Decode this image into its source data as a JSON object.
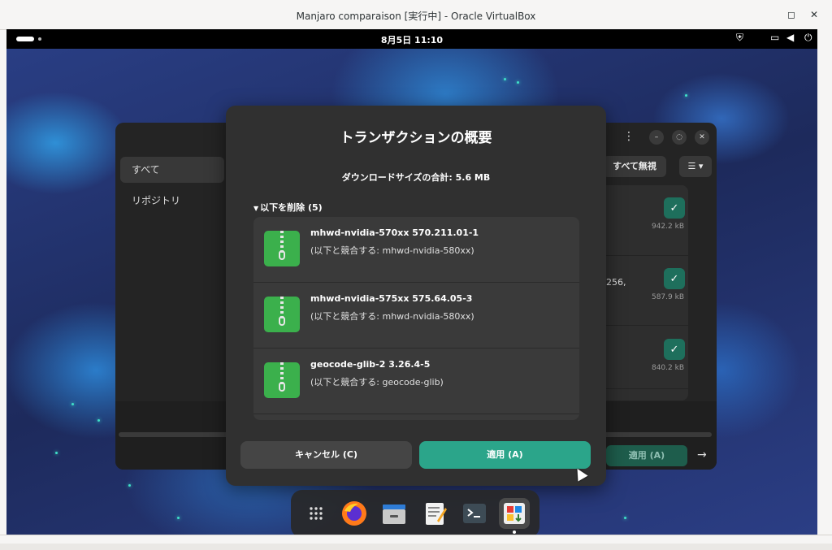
{
  "host": {
    "title": "Manjaro comparaison [実行中] - Oracle VirtualBox",
    "restore_glyph": "◻",
    "close_glyph": "✕"
  },
  "topbar": {
    "clock": "8月5日  11:10"
  },
  "background_window": {
    "sidebar": [
      "すべて",
      "リポジトリ"
    ],
    "ignore_all_label": "すべて無視",
    "view_label": "☰ ▾",
    "rows": [
      {
        "size": "942.2 kB",
        "trunc": ""
      },
      {
        "size": "587.9 kB",
        "trunc": "-256,"
      },
      {
        "size": "840.2 kB",
        "trunc": ""
      }
    ],
    "apply_label": "適用 (A)",
    "next_glyph": "→"
  },
  "dialog": {
    "title": "トランザクションの概要",
    "download_size": "ダウンロードサイズの合計: 5.6 MB",
    "section_header": "以下を削除 (5)",
    "packages": [
      {
        "name": "mhwd-nvidia-570xx  570.211.01-1",
        "conflict": "(以下と競合する: mhwd-nvidia-580xx)"
      },
      {
        "name": "mhwd-nvidia-575xx  575.64.05-3",
        "conflict": "(以下と競合する: mhwd-nvidia-580xx)"
      },
      {
        "name": "geocode-glib-2  3.26.4-5",
        "conflict": "(以下と競合する: geocode-glib)"
      }
    ],
    "cancel_label": "キャンセル (C)",
    "apply_label": "適用 (A)"
  },
  "dock": {
    "apps": [
      "app-grid-icon",
      "firefox-icon",
      "files-icon",
      "text-editor-icon",
      "terminal-icon",
      "software-icon"
    ]
  },
  "colors": {
    "accent": "#2ba58a",
    "check": "#1e6f5c",
    "package_icon": "#3bb04c"
  }
}
